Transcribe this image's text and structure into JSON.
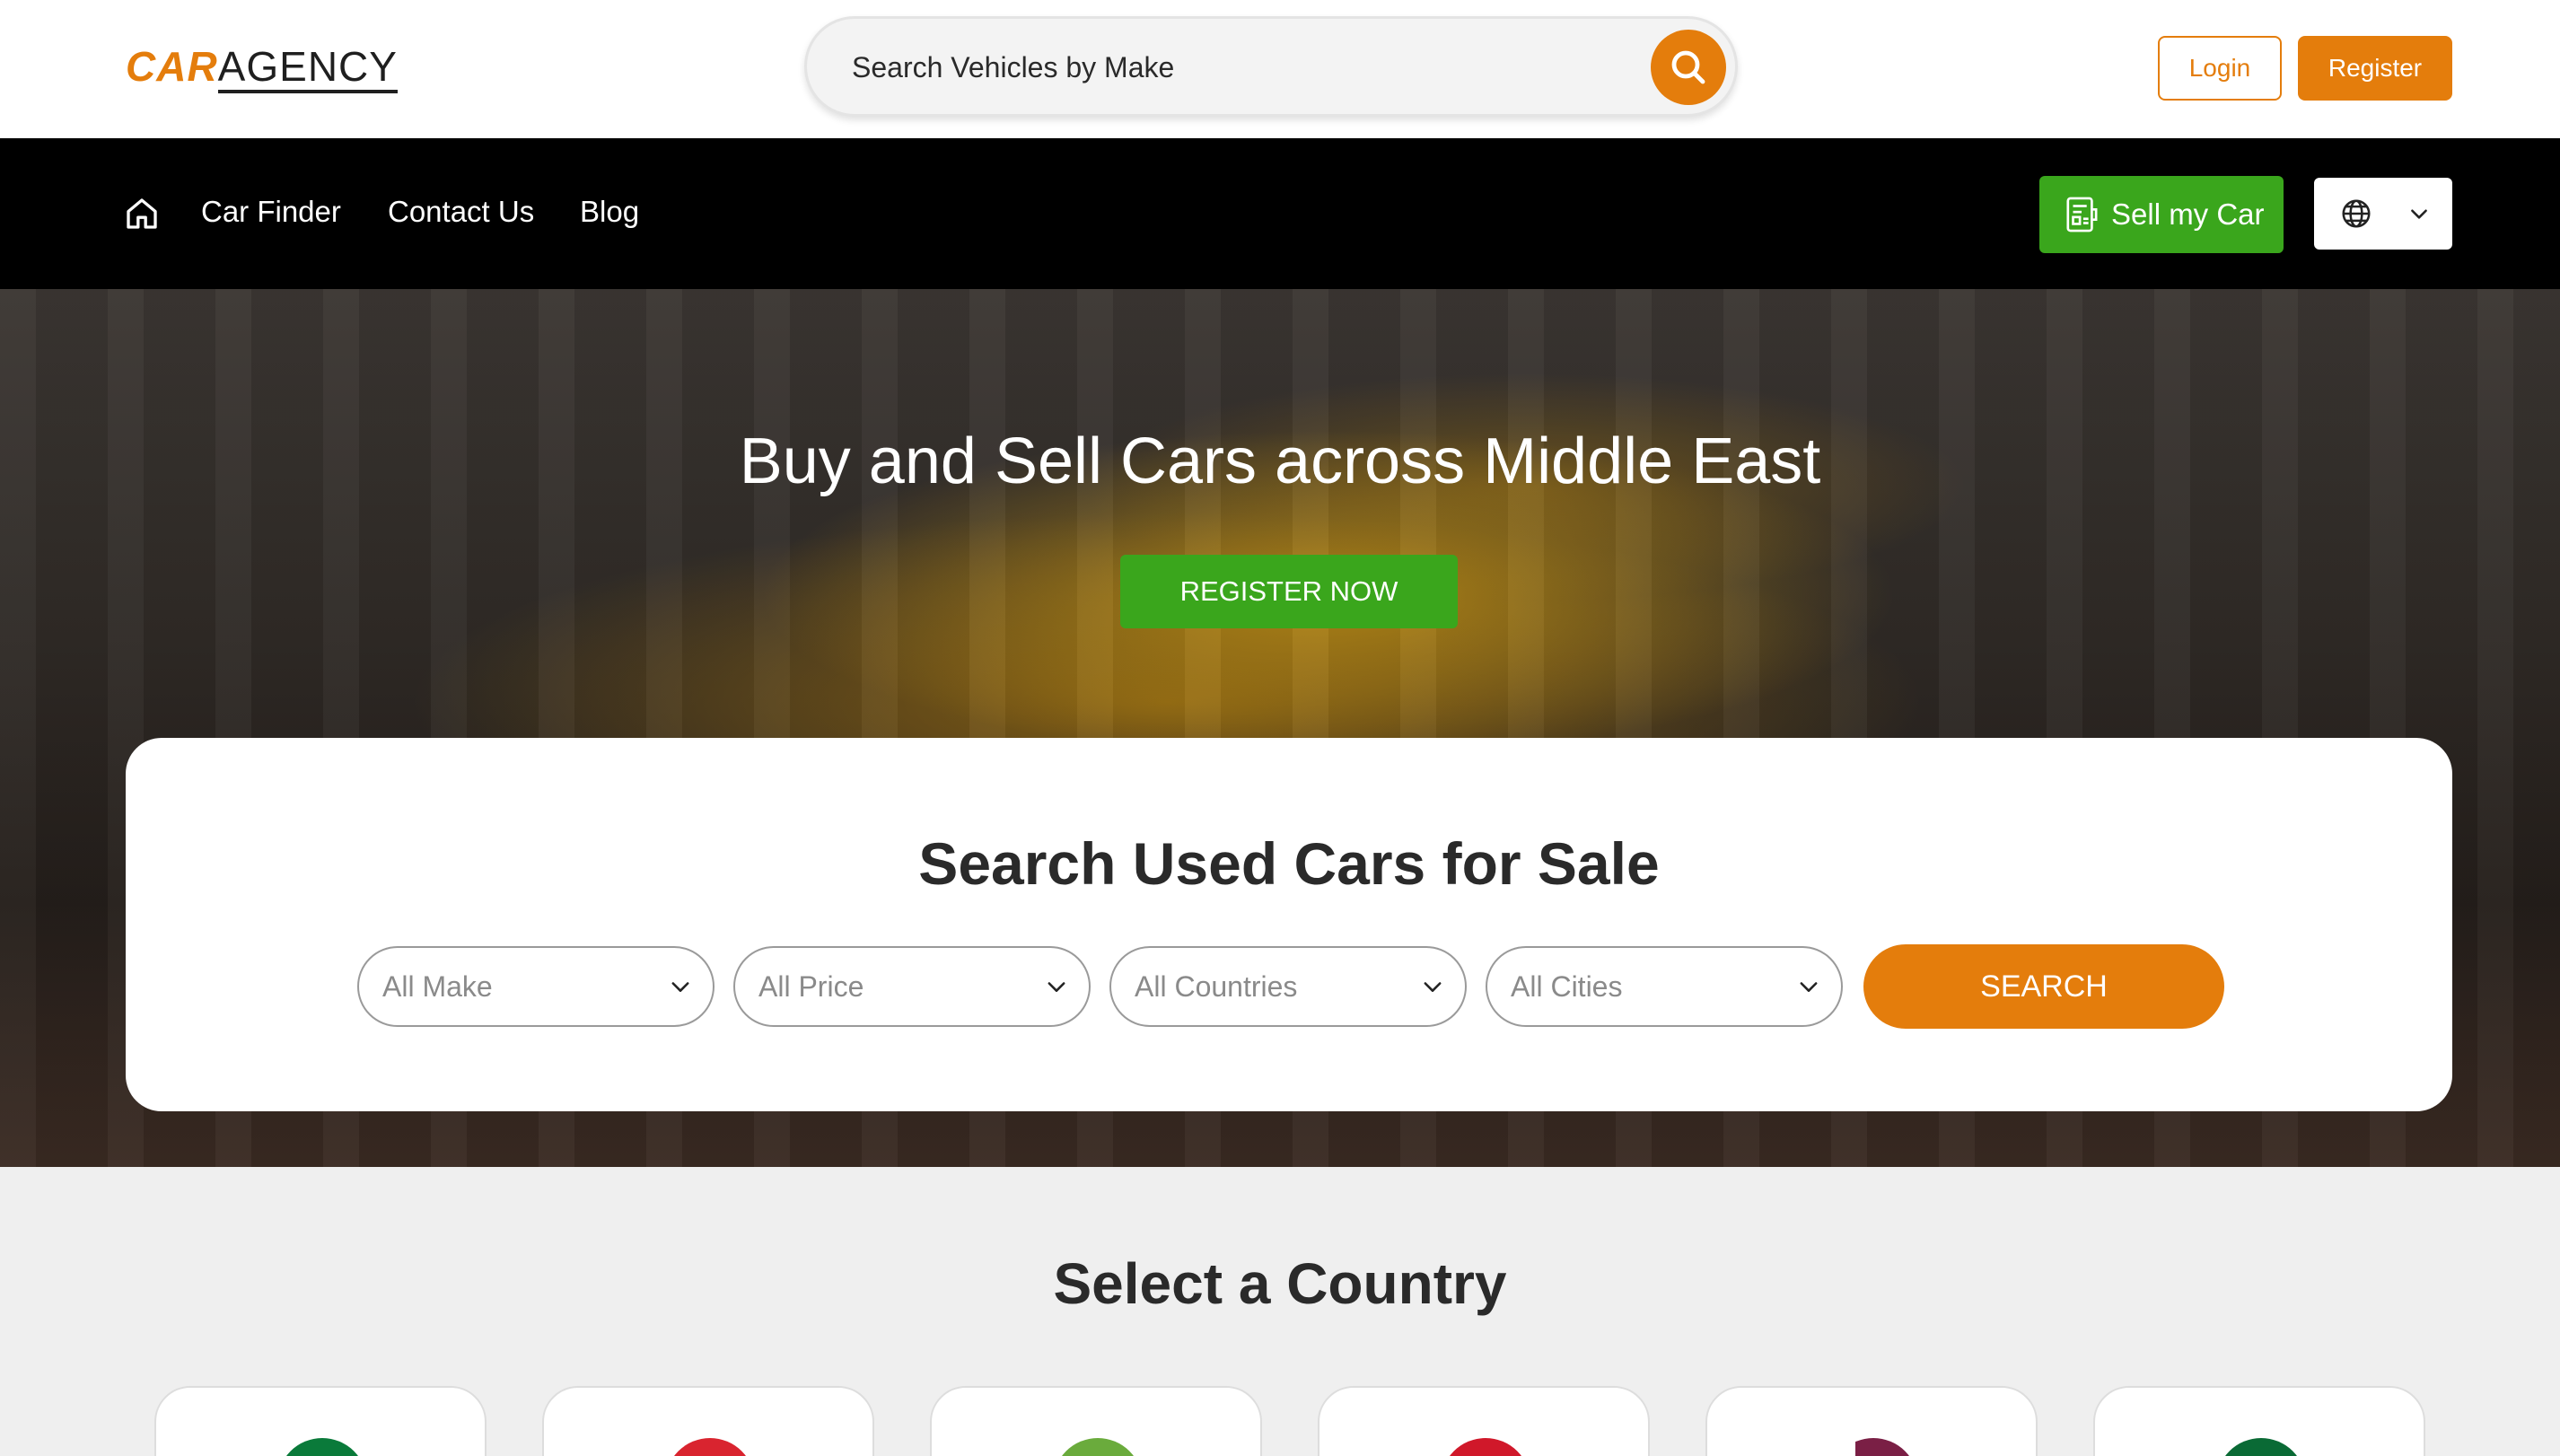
{
  "header": {
    "logo_car": "CAR",
    "logo_agency": "AGENCY",
    "search_placeholder": "Search Vehicles by Make",
    "search_icon": "search-icon",
    "login_label": "Login",
    "register_label": "Register"
  },
  "nav": {
    "home_icon": "home-icon",
    "links": [
      "Car Finder",
      "Contact Us",
      "Blog"
    ],
    "sell_label": "Sell my Car",
    "sell_icon": "receipt-icon",
    "language_icon": "globe-icon"
  },
  "hero": {
    "title": "Buy and Sell Cars across Middle East",
    "cta_label": "REGISTER NOW"
  },
  "search_card": {
    "title": "Search Used Cars for Sale",
    "filters": [
      "All Make",
      "All Price",
      "All Countries",
      "All Cities"
    ],
    "submit_label": "SEARCH"
  },
  "countries": {
    "title": "Select a Country",
    "flag_colors": [
      "#0a7a3a",
      "#d9242f",
      "#6aab3c",
      "#d0182a",
      "#7a1f45",
      "#0a6a35"
    ]
  },
  "colors": {
    "accent": "#e47d0c",
    "green": "#3aa61c",
    "nav_bg": "#000000"
  }
}
